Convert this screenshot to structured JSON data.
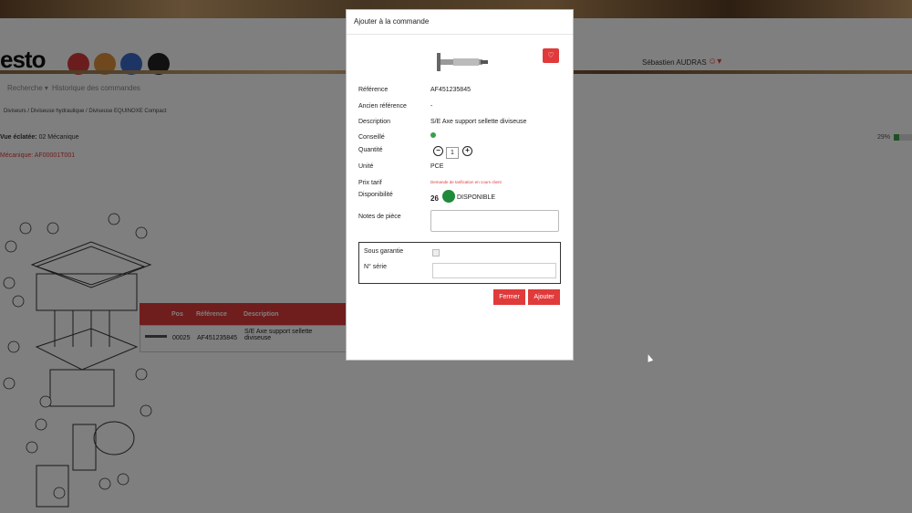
{
  "app": {
    "logo_text": "esto",
    "user_name": "Sébastien AUDRAS",
    "nav": {
      "recherche": "Recherche ▾",
      "historique": "Historique des commandes"
    },
    "breadcrumb": "Diviseurs  /  Diviseuse hydraulique  /  Diviseuse EQUINOXE Compact",
    "vue_label": "Vue éclatée:",
    "vue_value": "02 Mécanique",
    "mecanique_ref": "Mécanique: AF00001T001",
    "progress_text": "29%",
    "progress": 0.29,
    "brand_colors": [
      "#d63a3a",
      "#e0913a",
      "#3a6ac8",
      "#222222"
    ]
  },
  "table": {
    "headers": {
      "pos": "Pos",
      "reference": "Référence",
      "description": "Description"
    },
    "rows": [
      {
        "pos": "00025",
        "reference": "AF451235845",
        "description": "S/E Axe support sellette diviseuse"
      }
    ]
  },
  "modal": {
    "title": "Ajouter à la commande",
    "fields": {
      "reference_label": "Référence",
      "reference_value": "AF451235845",
      "ancienne_label": "Ancien référence",
      "ancienne_value": "-",
      "description_label": "Description",
      "description_value": "S/E Axe support sellette diviseuse",
      "conseille_label": "Conseillé",
      "quantite_label": "Quantité",
      "quantite_value": "1",
      "unite_label": "Unité",
      "unite_value": "PCE",
      "prix_label": "Prix tarif",
      "prix_value": "Demande de tarification en cours client",
      "disponibilite_label": "Disponibilité",
      "disponibilite_qty": "26",
      "disponibilite_status": "DISPONIBLE",
      "notes_label": "Notes de pièce",
      "garantie_label": "Sous garantie",
      "serie_label": "N° série"
    },
    "buttons": {
      "fermer": "Fermer",
      "ajouter": "Ajouter"
    },
    "icons": {
      "favorite": "heart-icon",
      "minus": "minus-circle-icon",
      "plus": "plus-circle-icon"
    }
  }
}
